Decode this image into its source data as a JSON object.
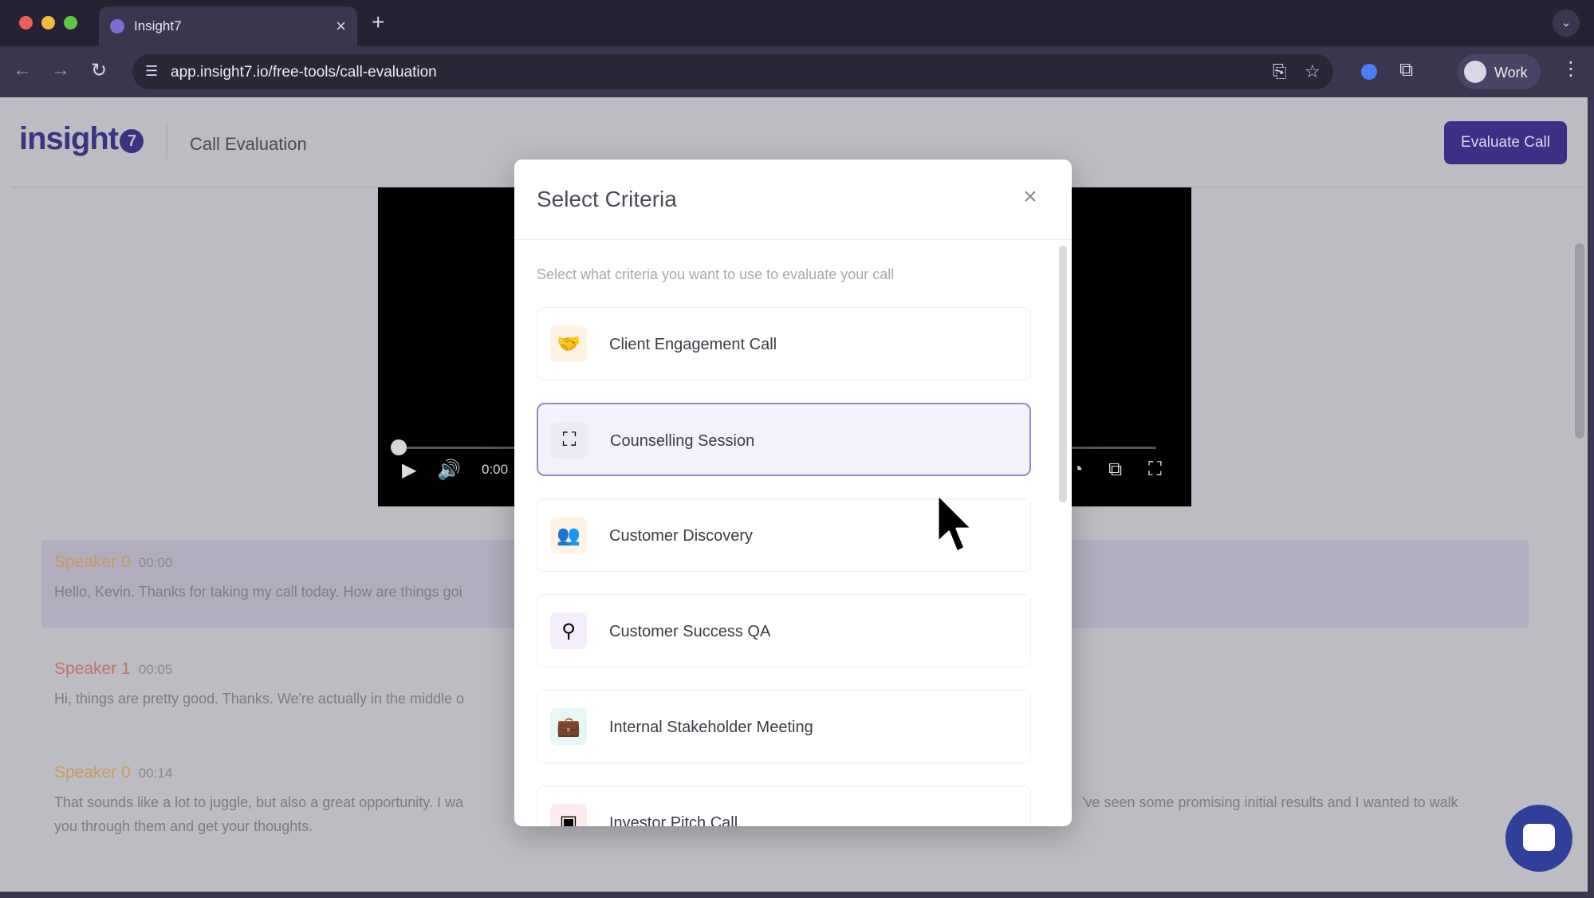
{
  "browser": {
    "tab_title": "Insight7",
    "tab_close": "×",
    "new_tab": "+",
    "url": "app.insight7.io/free-tools/call-evaluation",
    "profile_label": "Work"
  },
  "header": {
    "logo_text": "insight",
    "logo_mark": "7",
    "page_title": "Call Evaluation",
    "evaluate_button": "Evaluate Call"
  },
  "video": {
    "time": "0:00"
  },
  "transcript": [
    {
      "speaker": "Speaker 0",
      "time": "00:00",
      "text": "Hello, Kevin. Thanks for taking my call today. How are things goi"
    },
    {
      "speaker": "Speaker 1",
      "time": "00:05",
      "text": "Hi, things are pretty good. Thanks. We're actually in the middle o"
    },
    {
      "speaker": "Speaker 0",
      "time": "00:14",
      "text_left": "That sounds like a lot to juggle, but also a great opportunity. I wa",
      "text_right": "'ve seen some promising initial results and I wanted to walk",
      "text_line2": "you through them and get your thoughts."
    }
  ],
  "modal": {
    "title": "Select Criteria",
    "close": "×",
    "description": "Select what criteria you want to use to evaluate your call",
    "items": [
      {
        "label": "Client Engagement Call",
        "icon": "handshake-icon",
        "glyph": "🤝",
        "bg": "#fdf4e6"
      },
      {
        "label": "Counselling Session",
        "icon": "person-scan-icon",
        "glyph": "⛶",
        "bg": "#ecebf5"
      },
      {
        "label": "Customer Discovery",
        "icon": "people-group-icon",
        "glyph": "👥",
        "bg": "#fdf4e6"
      },
      {
        "label": "Customer Success QA",
        "icon": "search-icon",
        "glyph": "⚲",
        "bg": "#f3eefa"
      },
      {
        "label": "Internal Stakeholder Meeting",
        "icon": "briefcase-icon",
        "glyph": "💼",
        "bg": "#e6f7f6"
      },
      {
        "label": "Investor Pitch Call",
        "icon": "presentation-icon",
        "glyph": "▣",
        "bg": "#fcebef"
      }
    ],
    "selected_index": 1
  }
}
